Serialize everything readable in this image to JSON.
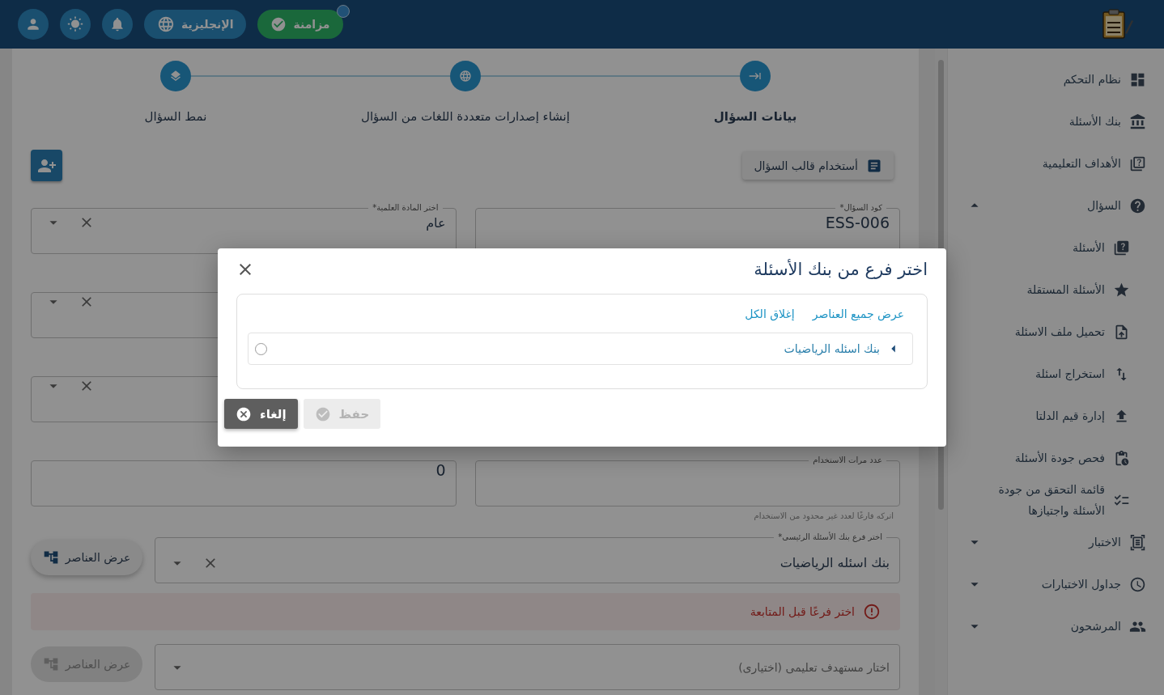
{
  "header": {
    "sync": {
      "label": "مزامنة",
      "synced": true
    },
    "language": "الإنجليزية"
  },
  "sidebar": {
    "items": [
      {
        "label": "نظام التحكم",
        "kind": "dashboard"
      },
      {
        "label": "بنك الأسئلة",
        "kind": "bank"
      },
      {
        "label": "الأهداف التعليمية",
        "kind": "objectives"
      },
      {
        "label": "السؤال",
        "kind": "question",
        "expanded": true,
        "children": [
          {
            "label": "الأسئلة",
            "kind": "questions"
          },
          {
            "label": "الأسئلة المستقلة",
            "kind": "standalone"
          },
          {
            "label": "تحميل ملف الاسئلة",
            "kind": "upload_file"
          },
          {
            "label": "استخراج اسئلة",
            "kind": "extract"
          },
          {
            "label": "إدارة قيم الدلتا",
            "kind": "delta"
          },
          {
            "label": "فحص جودة الأسئلة",
            "kind": "quality"
          },
          {
            "label": "قائمة التحقق من جودة الأسئلة واجتيازها",
            "kind": "checklist"
          }
        ]
      },
      {
        "label": "الاختبار",
        "kind": "exam",
        "expanded": false
      },
      {
        "label": "جداول الاختبارات",
        "kind": "schedule",
        "expanded": false
      },
      {
        "label": "المرشحون",
        "kind": "candidates",
        "expanded": false
      }
    ]
  },
  "stepper": {
    "steps": [
      {
        "label": "بيانات السؤال",
        "kind": "data",
        "selected": true
      },
      {
        "label": "إنشاء إصدارات متعددة اللغات من السؤال",
        "kind": "languages",
        "selected": false
      },
      {
        "label": "نمط السؤال",
        "kind": "pattern",
        "selected": false
      }
    ]
  },
  "toolbar": {
    "template_button": "أستخدام قالب السؤال"
  },
  "form": {
    "rows": [
      {
        "right": {
          "kind": "text",
          "label": "كود السؤال*",
          "value": "ESS-006"
        },
        "left": {
          "kind": "select",
          "label": "اختر المادة العلمية*",
          "value": "عام",
          "clearable": true
        }
      },
      {
        "left": {
          "kind": "select",
          "clearable": true
        }
      },
      {
        "left": {
          "kind": "select",
          "clearable": true
        }
      },
      {
        "right": {
          "kind": "text",
          "label": "عدد مرات الاستخدام",
          "helper": "اتركه فارغًا لعدد غير محدود من الاستخدام"
        },
        "left": {
          "kind": "text",
          "value": "0"
        }
      }
    ]
  },
  "sections": [
    {
      "kind": "picker",
      "button": {
        "label": "عرض العناصر",
        "disabled": false
      },
      "field": {
        "kind": "select",
        "label": "اختر فرع بنك الأسئلة الرئيسى*",
        "value": "بنك اسئله الرياضيات",
        "clearable": true
      }
    },
    {
      "kind": "error",
      "text": "اختر فرعًا قبل المتابعة"
    },
    {
      "kind": "picker",
      "button": {
        "label": "عرض العناصر",
        "disabled": true
      },
      "field": {
        "kind": "select",
        "placeholder": "اختار مستهدف تعليمى (اختيارى)",
        "clearable": false
      }
    }
  ],
  "modal": {
    "title": "اختر فرع من بنك الأسئلة",
    "links": [
      "عرض جميع العناصر",
      "إغلاق الكل"
    ],
    "tree": [
      {
        "label": "بنك اسئله الرياضيات",
        "expanded": false,
        "selected": false
      }
    ],
    "buttons": [
      {
        "label": "حفظ",
        "kind": "save",
        "disabled": true
      },
      {
        "label": "إلغاء",
        "kind": "cancel",
        "disabled": false
      }
    ]
  }
}
